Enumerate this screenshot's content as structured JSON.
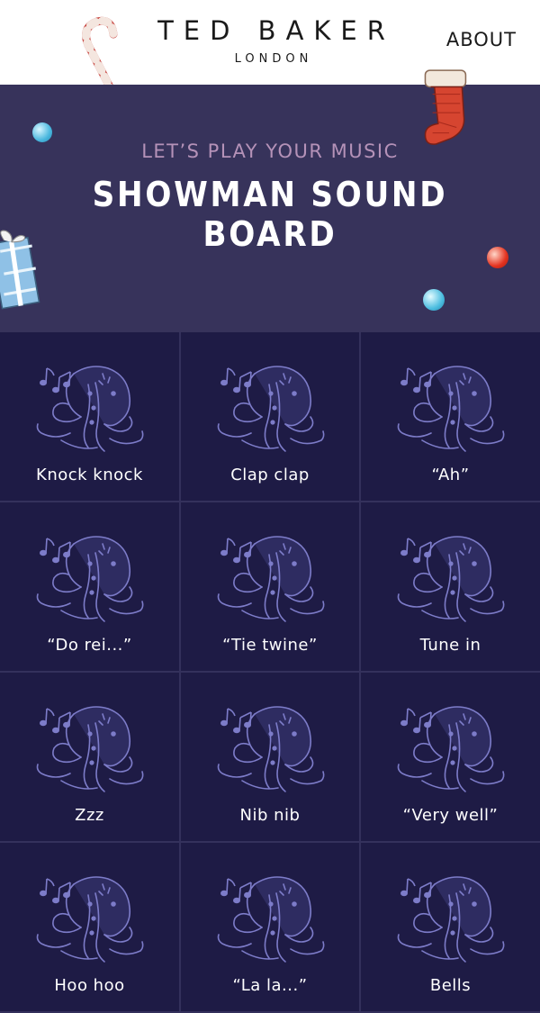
{
  "header": {
    "brand_name": "TED BAKER",
    "brand_sub": "LONDON",
    "about_label": "ABOUT"
  },
  "hero": {
    "subtitle": "LET’S PLAY YOUR MUSIC",
    "title": "SHOWMAN SOUND BOARD"
  },
  "colors": {
    "header_bg": "#ffffff",
    "hero_bg": "#37335b",
    "grid_bg": "#1e1b45",
    "tile_border": "#34315c",
    "subtitle": "#b592b8",
    "art_stroke": "#7d7cc9"
  },
  "tiles": [
    {
      "label": "Knock knock",
      "icon": "octopus-music-icon"
    },
    {
      "label": "Clap clap",
      "icon": "octopus-music-icon"
    },
    {
      "label": "“Ah”",
      "icon": "octopus-music-icon"
    },
    {
      "label": "“Do rei...”",
      "icon": "octopus-music-icon"
    },
    {
      "label": "“Tie twine”",
      "icon": "octopus-music-icon"
    },
    {
      "label": "Tune in",
      "icon": "octopus-music-icon"
    },
    {
      "label": "Zzz",
      "icon": "octopus-music-icon"
    },
    {
      "label": "Nib nib",
      "icon": "octopus-music-icon"
    },
    {
      "label": "“Very well”",
      "icon": "octopus-music-icon"
    },
    {
      "label": "Hoo hoo",
      "icon": "octopus-music-icon"
    },
    {
      "label": "“La la...”",
      "icon": "octopus-music-icon"
    },
    {
      "label": "Bells",
      "icon": "octopus-music-icon"
    }
  ]
}
